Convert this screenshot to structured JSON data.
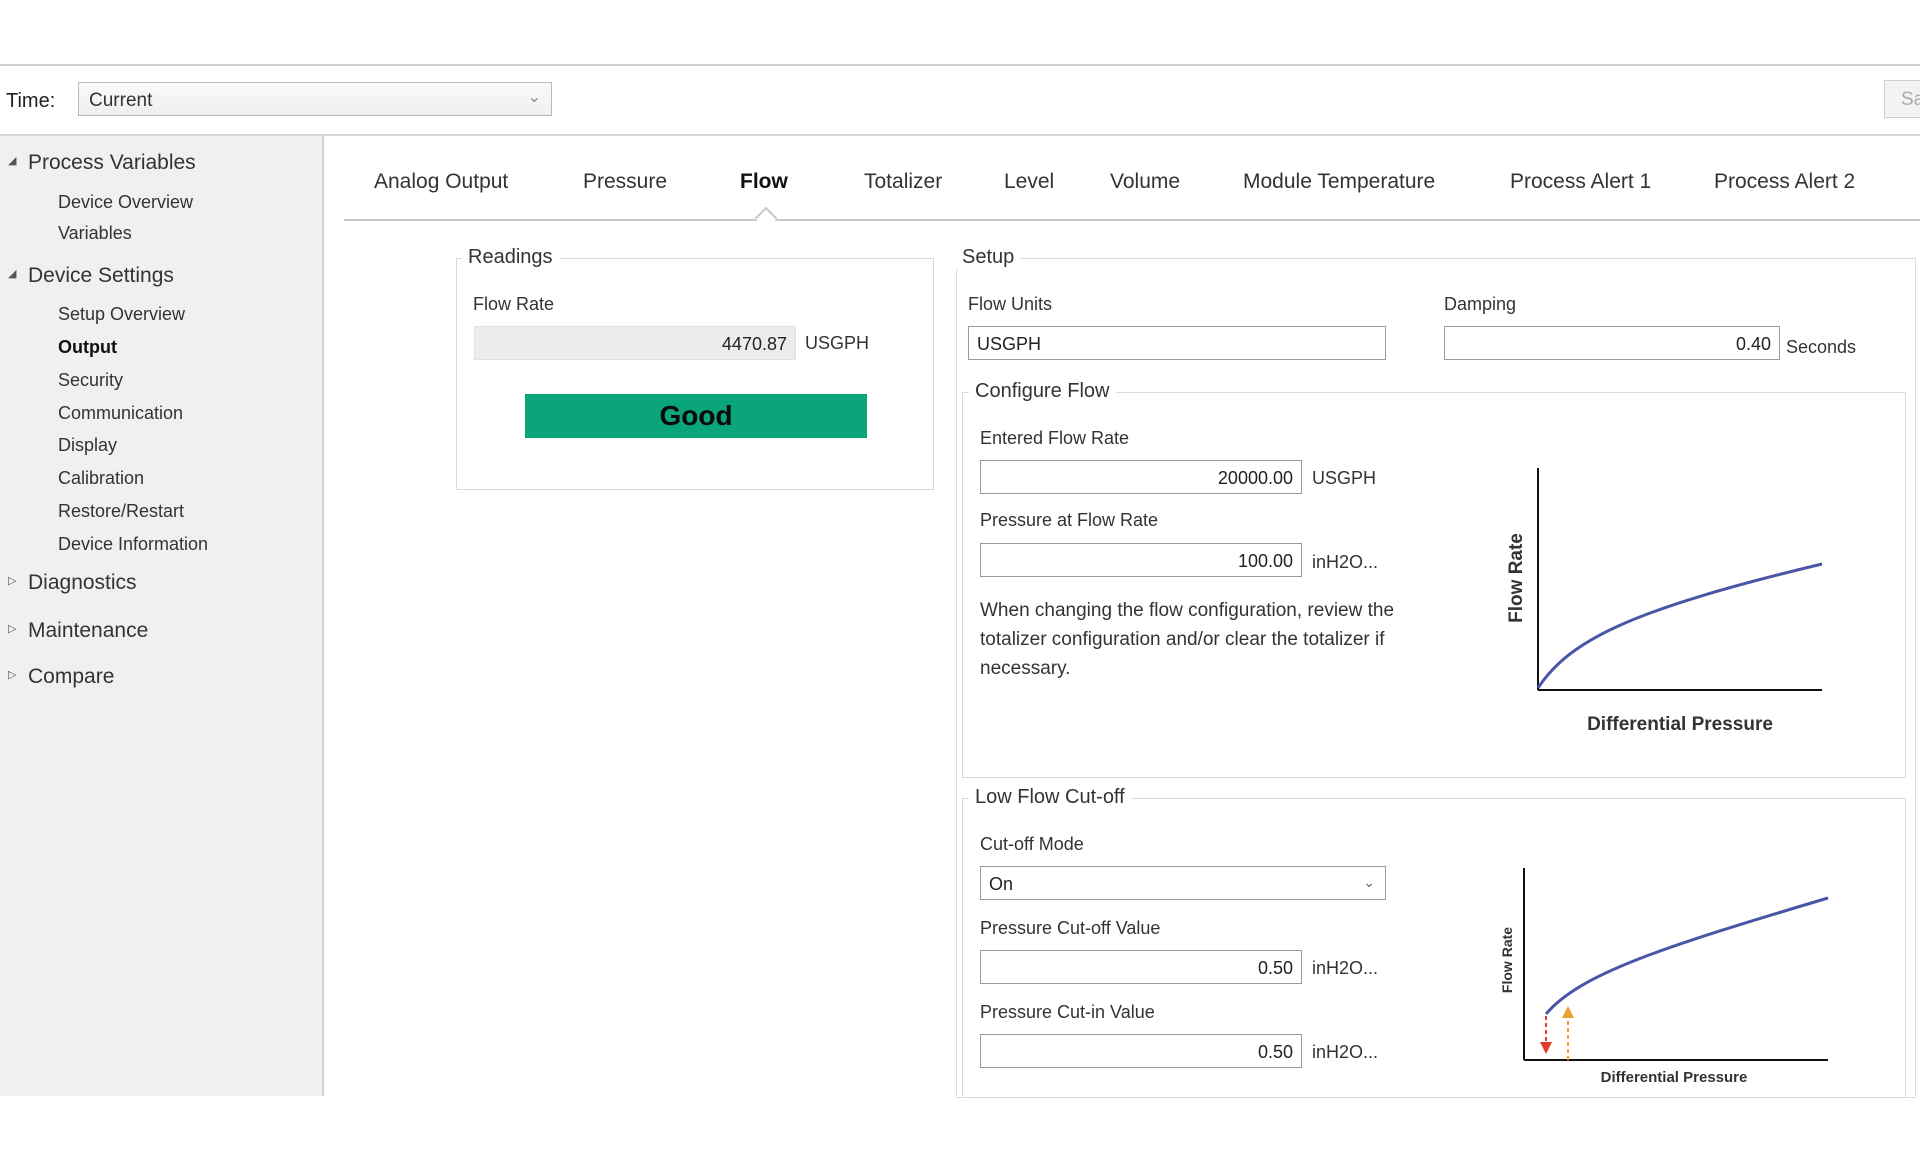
{
  "toolbar": {
    "time_label": "Time:",
    "time_value": "Current",
    "save_label": "Sa"
  },
  "sidebar": {
    "process_variables": "Process Variables",
    "pv_items": [
      "Device Overview",
      "Variables"
    ],
    "device_settings": "Device Settings",
    "ds_items": [
      "Setup Overview",
      "Output",
      "Security",
      "Communication",
      "Display",
      "Calibration",
      "Restore/Restart",
      "Device Information"
    ],
    "diagnostics": "Diagnostics",
    "maintenance": "Maintenance",
    "compare": "Compare"
  },
  "tabs": [
    "Analog Output",
    "Pressure",
    "Flow",
    "Totalizer",
    "Level",
    "Volume",
    "Module Temperature",
    "Process Alert 1",
    "Process Alert 2"
  ],
  "readings": {
    "title": "Readings",
    "flow_rate_label": "Flow Rate",
    "flow_rate_value": "4470.87",
    "flow_rate_unit": "USGPH",
    "status": "Good"
  },
  "setup": {
    "title": "Setup",
    "flow_units_label": "Flow Units",
    "flow_units_value": "USGPH",
    "damping_label": "Damping",
    "damping_value": "0.40",
    "damping_unit": "Seconds"
  },
  "configure_flow": {
    "title": "Configure Flow",
    "entered_label": "Entered Flow Rate",
    "entered_value": "20000.00",
    "entered_unit": "USGPH",
    "pressure_label": "Pressure at Flow Rate",
    "pressure_value": "100.00",
    "pressure_unit": "inH2O...",
    "note": "When changing the flow configuration, review the totalizer configuration and/or clear the totalizer if necessary.",
    "graph_ylabel": "Flow Rate",
    "graph_xlabel": "Differential Pressure"
  },
  "low_flow": {
    "title": "Low Flow Cut-off",
    "mode_label": "Cut-off Mode",
    "mode_value": "On",
    "cutoff_label": "Pressure Cut-off Value",
    "cutoff_value": "0.50",
    "cutoff_unit": "inH2O...",
    "cutin_label": "Pressure Cut-in Value",
    "cutin_value": "0.50",
    "cutin_unit": "inH2O...",
    "graph_ylabel": "Flow Rate",
    "graph_xlabel": "Differential Pressure"
  },
  "colors": {
    "good": "#0aa57a",
    "curve": "#4a55a8",
    "arrow_down": "#e03a2a",
    "arrow_up": "#f0a030"
  }
}
